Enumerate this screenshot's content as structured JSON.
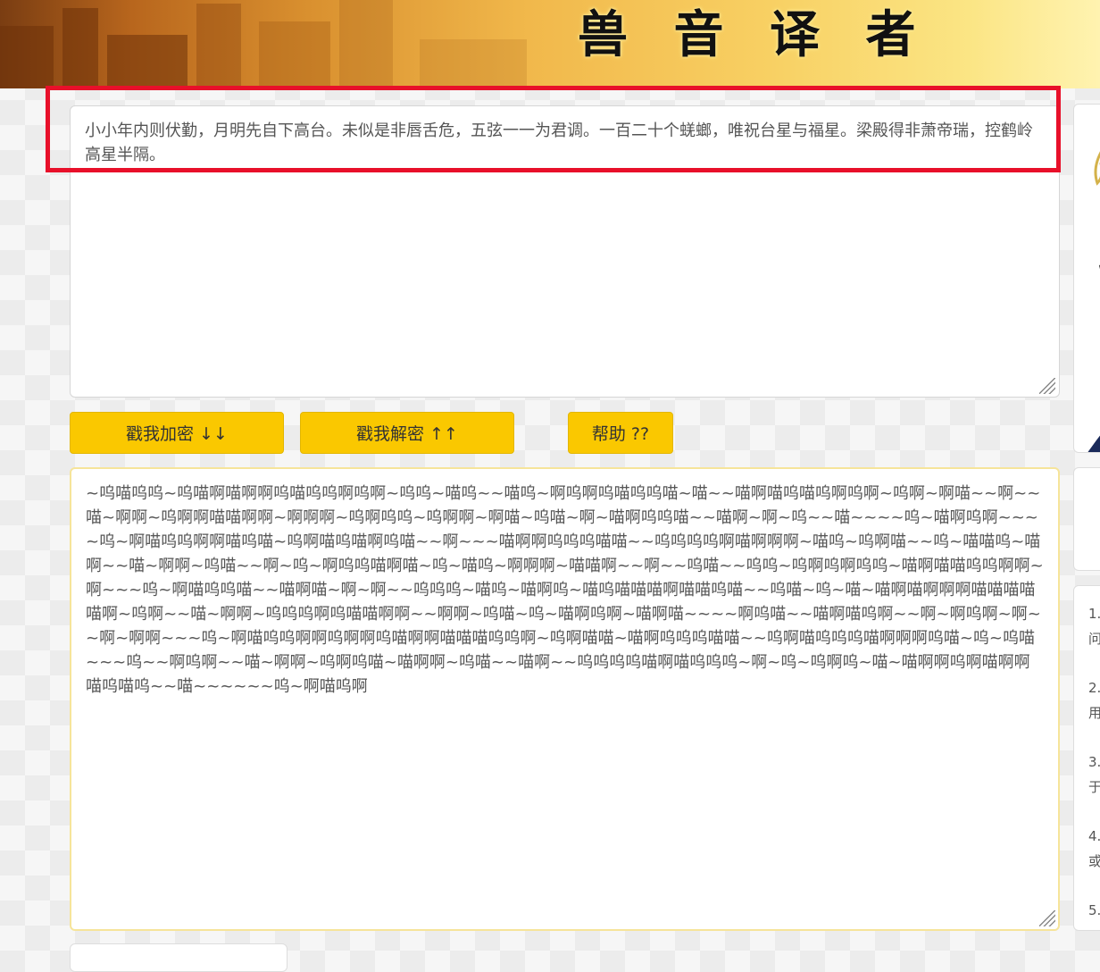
{
  "banner": {
    "title": "兽 音 译 者"
  },
  "input": {
    "value": "小小年内则伏勤，月明先自下高台。未似是非唇舌危，五弦一一为君调。一百二十个蜣螂，唯祝台星与福星。梁殿得非萧帝瑞，控鹤岭高星半隔。"
  },
  "buttons": {
    "encrypt": "戳我加密 ↓↓",
    "decrypt": "戳我解密 ↑↑",
    "help": "帮助 ??"
  },
  "output": {
    "value": "~呜喵呜呜~呜喵啊喵啊啊呜喵呜呜啊呜啊~呜呜~喵呜~~喵呜~啊呜啊呜喵呜呜喵~喵~~喵啊喵呜喵呜啊呜啊~呜啊~啊喵~~啊~~喵~啊啊~呜啊啊喵喵啊啊~啊啊啊~呜啊呜呜~呜啊啊~啊喵~呜喵~啊~喵啊呜呜喵~~喵啊~啊~呜~~喵~~~~呜~喵啊呜啊~~~~呜~啊喵呜呜啊啊喵呜喵~呜啊喵呜喵啊呜喵~~啊~~~喵啊啊呜呜呜喵喵~~呜呜呜呜啊喵啊啊啊~喵呜~呜啊喵~~呜~喵喵呜~喵啊~~喵~啊啊~呜喵~~啊~呜~啊呜呜喵啊喵~呜~喵呜~啊啊啊~喵喵啊~~啊~~呜喵~~呜呜~呜啊呜啊呜呜~喵啊喵喵呜呜啊啊~啊~~~呜~啊喵呜呜喵~~喵啊喵~啊~啊~~呜呜呜~喵呜~喵啊呜~喵呜喵喵喵啊喵喵呜喵~~呜喵~呜~喵~喵啊喵啊啊啊喵喵喵喵喵啊~呜啊~~喵~啊啊~呜呜呜啊呜喵喵啊啊~~啊啊~呜喵~呜~喵啊呜啊~喵啊喵~~~~啊呜喵~~喵啊喵呜啊~~啊~啊呜啊~啊~~啊~啊啊~~~呜~啊喵呜呜啊啊呜啊啊呜喵啊啊喵喵喵呜呜啊~呜啊喵喵~喵啊呜呜呜喵喵~~呜啊喵呜呜呜喵啊啊啊呜喵~呜~呜喵~~~呜~~啊呜啊~~喵~啊啊~呜啊呜喵~喵啊啊~呜喵~~喵啊~~呜呜呜呜喵啊喵呜呜呜~啊~呜~呜啊呜~喵~喵啊啊呜啊喵啊啊喵呜喵呜~~喵~~~~~~呜~啊喵呜啊"
  },
  "help_panel": {
    "items": [
      {
        "num": "1.",
        "text": "问"
      },
      {
        "num": "2.",
        "text": "用"
      },
      {
        "num": "3.",
        "text": "于"
      },
      {
        "num": "4.",
        "text": "或"
      },
      {
        "num": "5.",
        "text": ""
      }
    ]
  },
  "colors": {
    "button_bg": "#fac800",
    "highlight": "#e8102a",
    "output_border": "#f6e49a"
  }
}
